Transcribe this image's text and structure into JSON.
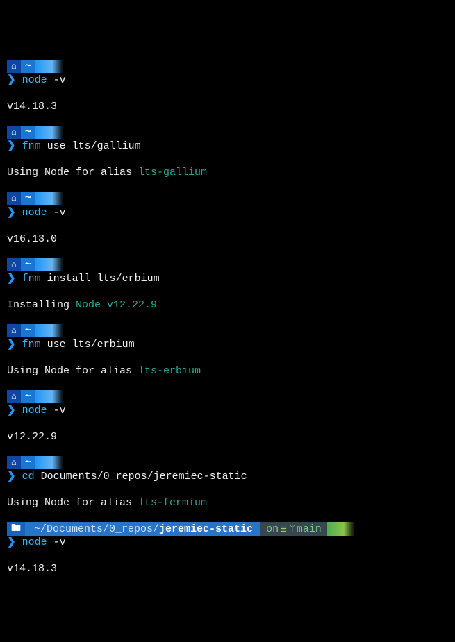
{
  "prompt": {
    "arrow": "❯",
    "tilde": "~"
  },
  "blocks": [
    {
      "cmd": {
        "bin": "node",
        "args": "-v"
      },
      "output": [
        {
          "text": "v14.18.3"
        }
      ]
    },
    {
      "cmd": {
        "bin": "fnm",
        "args": "use lts/gallium"
      },
      "output": [
        {
          "text": "Using Node for alias ",
          "alias": "lts-gallium"
        }
      ]
    },
    {
      "cmd": {
        "bin": "node",
        "args": "-v"
      },
      "output": [
        {
          "text": "v16.13.0"
        }
      ]
    },
    {
      "cmd": {
        "bin": "fnm",
        "args": "install lts/erbium"
      },
      "output": [
        {
          "text": "Installing ",
          "alias": "Node v12.22.9"
        }
      ]
    },
    {
      "cmd": {
        "bin": "fnm",
        "args": "use lts/erbium"
      },
      "output": [
        {
          "text": "Using Node for alias ",
          "alias": "lts-erbium"
        }
      ]
    },
    {
      "cmd": {
        "bin": "node",
        "args": "-v"
      },
      "output": [
        {
          "text": "v12.22.9"
        }
      ]
    },
    {
      "cmd": {
        "bin": "cd",
        "args_underline": "Documents/0_repos/jeremiec-static"
      },
      "output": [
        {
          "text": "Using Node for alias ",
          "alias": "lts-fermium"
        }
      ]
    }
  ],
  "repo_prompt": {
    "path_prefix": "~/Documents/0_repos/",
    "repo_name": "jeremiec-static",
    "git_on": "on",
    "branch": "main"
  },
  "last": {
    "cmd": {
      "bin": "node",
      "args": "-v"
    },
    "output": "v14.18.3"
  }
}
